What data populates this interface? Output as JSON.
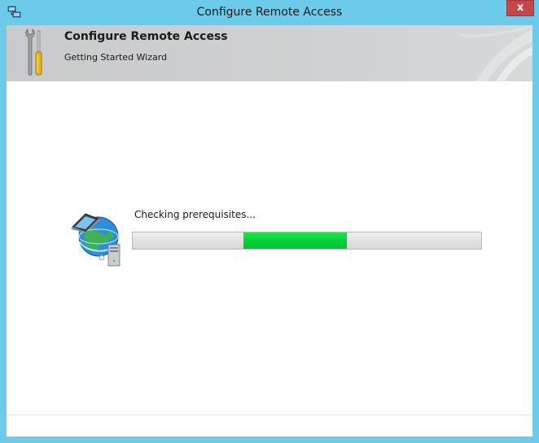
{
  "window": {
    "title": "Configure Remote Access",
    "close_label": "x",
    "border_color": "#6ccbe8",
    "close_color": "#c7464a"
  },
  "banner": {
    "title": "Configure Remote Access",
    "subtitle": "Getting Started Wizard",
    "icon": "tools-icon"
  },
  "progress": {
    "status": "Checking prerequisites...",
    "indicator_start": 0.318,
    "indicator_end": 0.614,
    "fill_color": "#06d23a",
    "icon": "network-globe-icon"
  }
}
